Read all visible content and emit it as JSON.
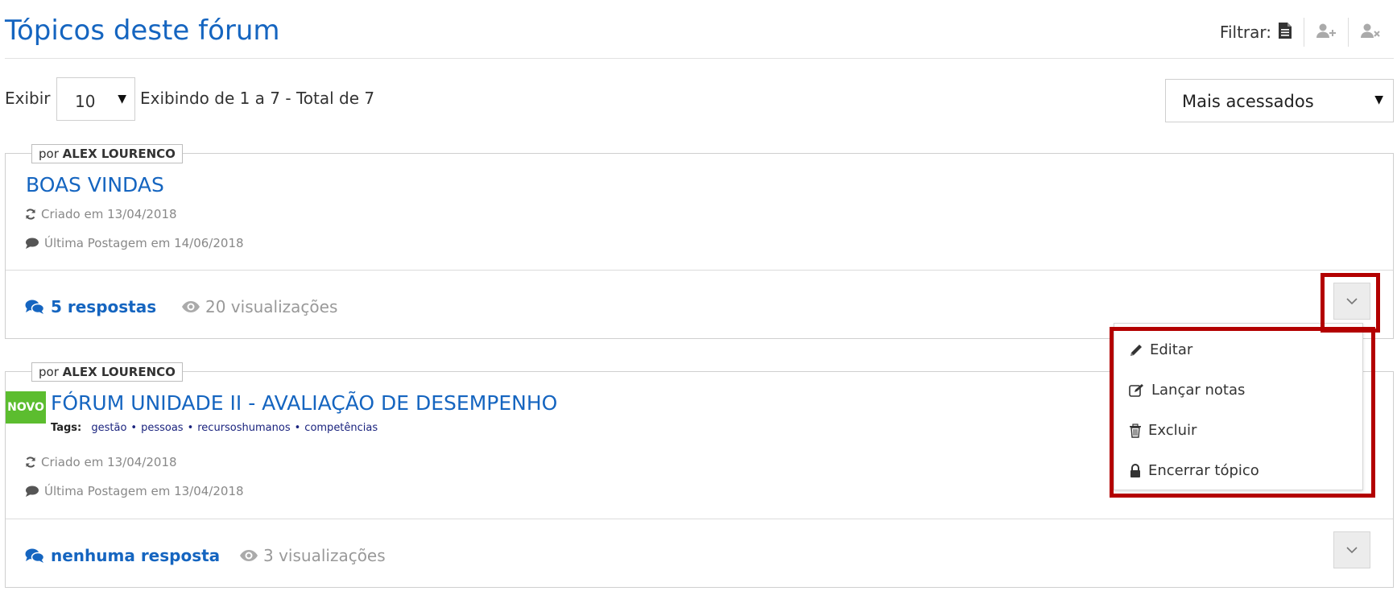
{
  "header": {
    "title": "Tópicos deste fórum",
    "filter_label": "Filtrar:",
    "filter_icons": [
      "document-icon",
      "user-plus-icon",
      "user-remove-icon"
    ]
  },
  "listing": {
    "show_label": "Exibir",
    "per_page": "10",
    "paging_info": "Exibindo de 1 a 7 - Total de 7",
    "sort_selected": "Mais acessados"
  },
  "topics": [
    {
      "author_prefix": "por",
      "author": "ALEX LOURENCO",
      "title": "BOAS VINDAS",
      "created": "Criado em 13/04/2018",
      "last_post": "Última Postagem em 14/06/2018",
      "replies": "5 respostas",
      "views": "20 visualizações"
    },
    {
      "author_prefix": "por",
      "author": "ALEX LOURENCO",
      "badge": "NOVO",
      "title": "FÓRUM UNIDADE II - AVALIAÇÃO DE DESEMPENHO",
      "tags_label": "Tags:",
      "tags": [
        "gestão",
        "pessoas",
        "recursoshumanos",
        "competências"
      ],
      "created": "Criado em 13/04/2018",
      "last_post": "Última Postagem em 13/04/2018",
      "replies": "nenhuma resposta",
      "views": "3 visualizações"
    }
  ],
  "dropdown_menu": {
    "items": [
      {
        "label": "Editar",
        "icon": "pencil-icon"
      },
      {
        "label": "Lançar notas",
        "icon": "edit-notes-icon"
      },
      {
        "label": "Excluir",
        "icon": "trash-icon"
      },
      {
        "label": "Encerrar tópico",
        "icon": "lock-icon"
      }
    ]
  },
  "colors": {
    "accent": "#1565c0",
    "badge_green": "#5cbd2f",
    "highlight_red": "#b30000",
    "muted": "#888888"
  }
}
